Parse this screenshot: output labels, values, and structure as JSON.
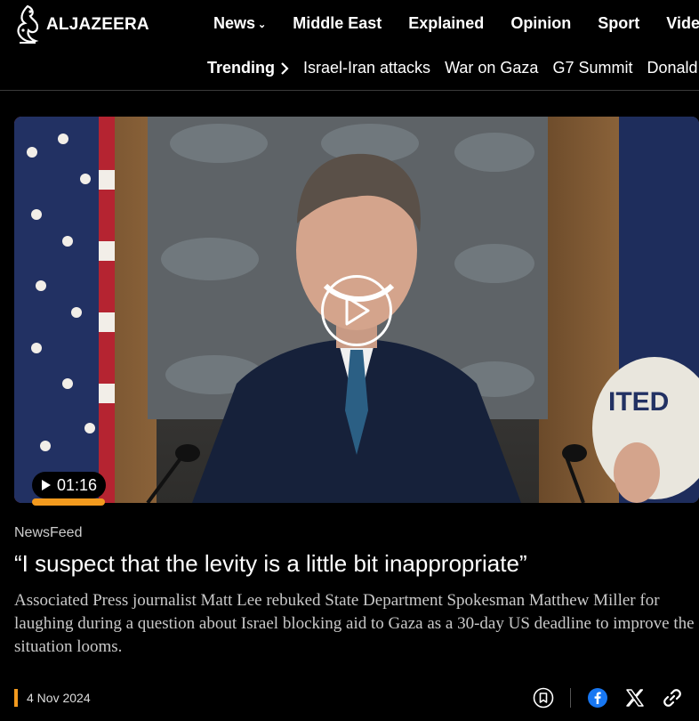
{
  "brand": {
    "logo_text": "ALJAZEERA"
  },
  "nav": {
    "items": [
      {
        "label": "News",
        "has_dropdown": true
      },
      {
        "label": "Middle East"
      },
      {
        "label": "Explained"
      },
      {
        "label": "Opinion"
      },
      {
        "label": "Sport"
      },
      {
        "label": "Video"
      }
    ]
  },
  "trending": {
    "label": "Trending",
    "items": [
      "Israel-Iran attacks",
      "War on Gaza",
      "G7 Summit",
      "Donald Trump"
    ]
  },
  "video": {
    "duration": "01:16",
    "progress_fraction": 0.19
  },
  "article": {
    "category": "NewsFeed",
    "title": "“I suspect that the levity is a little bit inappropriate”",
    "description": "Associated Press journalist Matt Lee rebuked State Department Spokesman Matthew Miller for laughing during a question about Israel blocking aid to Gaza as a 30-day US deadline to improve the situation looms.",
    "date": "4 Nov 2024"
  },
  "actions": {
    "icons": [
      "bookmark-icon",
      "facebook-icon",
      "x-icon",
      "link-icon"
    ]
  },
  "colors": {
    "accent": "#f39a1e",
    "background": "#000000",
    "facebook": "#1877f2"
  }
}
